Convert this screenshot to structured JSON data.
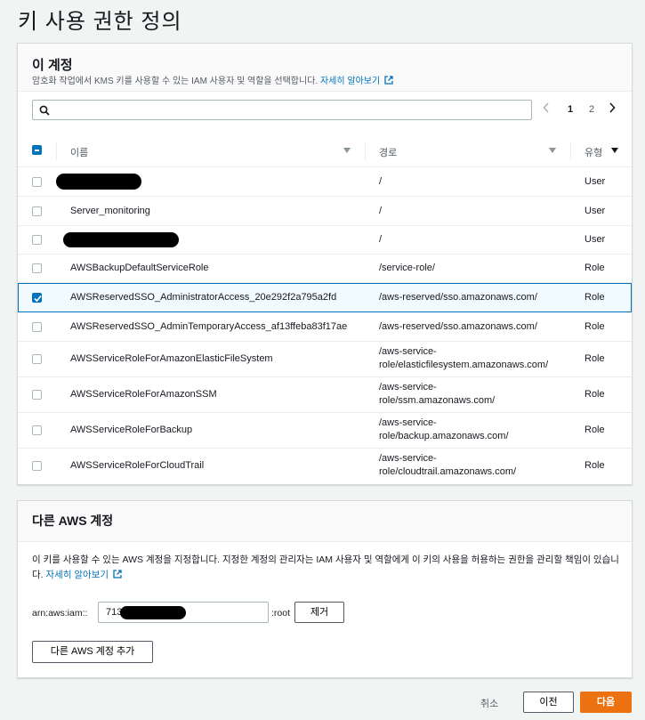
{
  "page": {
    "title": "키 사용 권한 정의"
  },
  "this_account": {
    "title": "이 계정",
    "description": "암호화 작업에서 KMS 키를 사용할 수 있는 IAM 사용자 및 역할을 선택합니다.",
    "learn_more": "자세히 알아보기",
    "search": {
      "placeholder": "",
      "value": ""
    },
    "pagination": {
      "prev": "‹",
      "pages": [
        "1",
        "2"
      ],
      "current": "1",
      "next": "›"
    },
    "columns": {
      "name": "이름",
      "path": "경로",
      "type": "유형"
    },
    "rows": [
      {
        "name": "",
        "path": "/",
        "type": "User",
        "redacted": true,
        "checked": false
      },
      {
        "name": "Server_monitoring",
        "path": "/",
        "type": "User",
        "checked": false
      },
      {
        "name": "",
        "path": "/",
        "type": "User",
        "redacted": true,
        "checked": false
      },
      {
        "name": "AWSBackupDefaultServiceRole",
        "path": "/service-role/",
        "type": "Role",
        "checked": false
      },
      {
        "name": "AWSReservedSSO_AdministratorAccess_20e292f2a795a2fd",
        "path": "/aws-reserved/sso.amazonaws.com/",
        "type": "Role",
        "checked": true
      },
      {
        "name": "AWSReservedSSO_AdminTemporaryAccess_af13ffeba83f17ae",
        "path": "/aws-reserved/sso.amazonaws.com/",
        "type": "Role",
        "checked": false
      },
      {
        "name": "AWSServiceRoleForAmazonElasticFileSystem",
        "path_line1": "/aws-service-",
        "path_line2": "role/elasticfilesystem.amazonaws.com/",
        "type": "Role",
        "checked": false
      },
      {
        "name": "AWSServiceRoleForAmazonSSM",
        "path_line1": "/aws-service-",
        "path_line2": "role/ssm.amazonaws.com/",
        "type": "Role",
        "checked": false
      },
      {
        "name": "AWSServiceRoleForBackup",
        "path_line1": "/aws-service-",
        "path_line2": "role/backup.amazonaws.com/",
        "type": "Role",
        "checked": false
      },
      {
        "name": "AWSServiceRoleForCloudTrail",
        "path_line1": "/aws-service-",
        "path_line2": "role/cloudtrail.amazonaws.com/",
        "type": "Role",
        "checked": false
      }
    ]
  },
  "other_accounts": {
    "title": "다른 AWS 계정",
    "description": "이 키를 사용할 수 있는 AWS 계정을 지정합니다. 지정한 계정의 관리자는 IAM 사용자 및 역할에게 이 키의 사용을 허용하는 권한을 관리할 책임이 있습니다.",
    "learn_more": "자세히 알아보기",
    "arn_prefix": "arn:aws:iam::",
    "account_value": "713",
    "arn_suffix": ":root",
    "remove_label": "제거",
    "add_label": "다른 AWS 계정 추가"
  },
  "footer": {
    "cancel": "취소",
    "previous": "이전",
    "next": "다음"
  },
  "colors": {
    "accent": "#0073bb",
    "primary_button": "#ec7211"
  }
}
